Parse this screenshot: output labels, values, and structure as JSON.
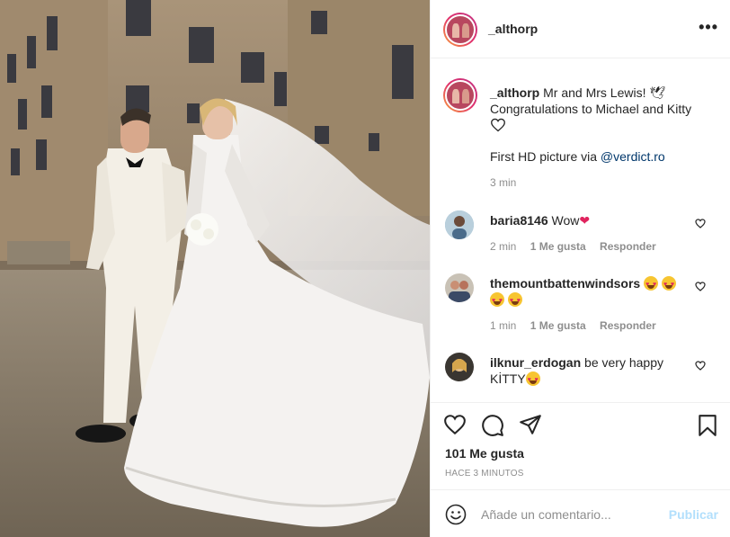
{
  "photo": {
    "description_icon": "wedding-photo"
  },
  "header": {
    "username": "_althorp",
    "more_icon": "ellipsis-icon",
    "more_label": "•••"
  },
  "caption": {
    "username": "_althorp",
    "text": " Mr and Mrs Lewis! 🕊 Congratulations to Michael and Kitty",
    "text2_prefix": "First HD picture via ",
    "mention": "@verdict.ro",
    "time": "3 min"
  },
  "comments": [
    {
      "username": "baria8146",
      "text": " Wow",
      "emoji": "❤",
      "time": "2 min",
      "likes": "1 Me gusta",
      "reply": "Responder"
    },
    {
      "username": "themountbattenwindsors",
      "text": " ",
      "time": "1 min",
      "likes": "1 Me gusta",
      "reply": "Responder"
    },
    {
      "username": "ilknur_erdogan",
      "text": " be very happy KİTTY"
    }
  ],
  "actions": {
    "likes": "101 Me gusta",
    "ago": "HACE 3 MINUTOS"
  },
  "add_comment": {
    "placeholder": "Añade un comentario...",
    "publish": "Publicar"
  },
  "colors": {
    "link": "#00376b",
    "muted": "#8e8e8e",
    "publish_disabled": "#b2dffc",
    "heart": "#e0245e"
  }
}
